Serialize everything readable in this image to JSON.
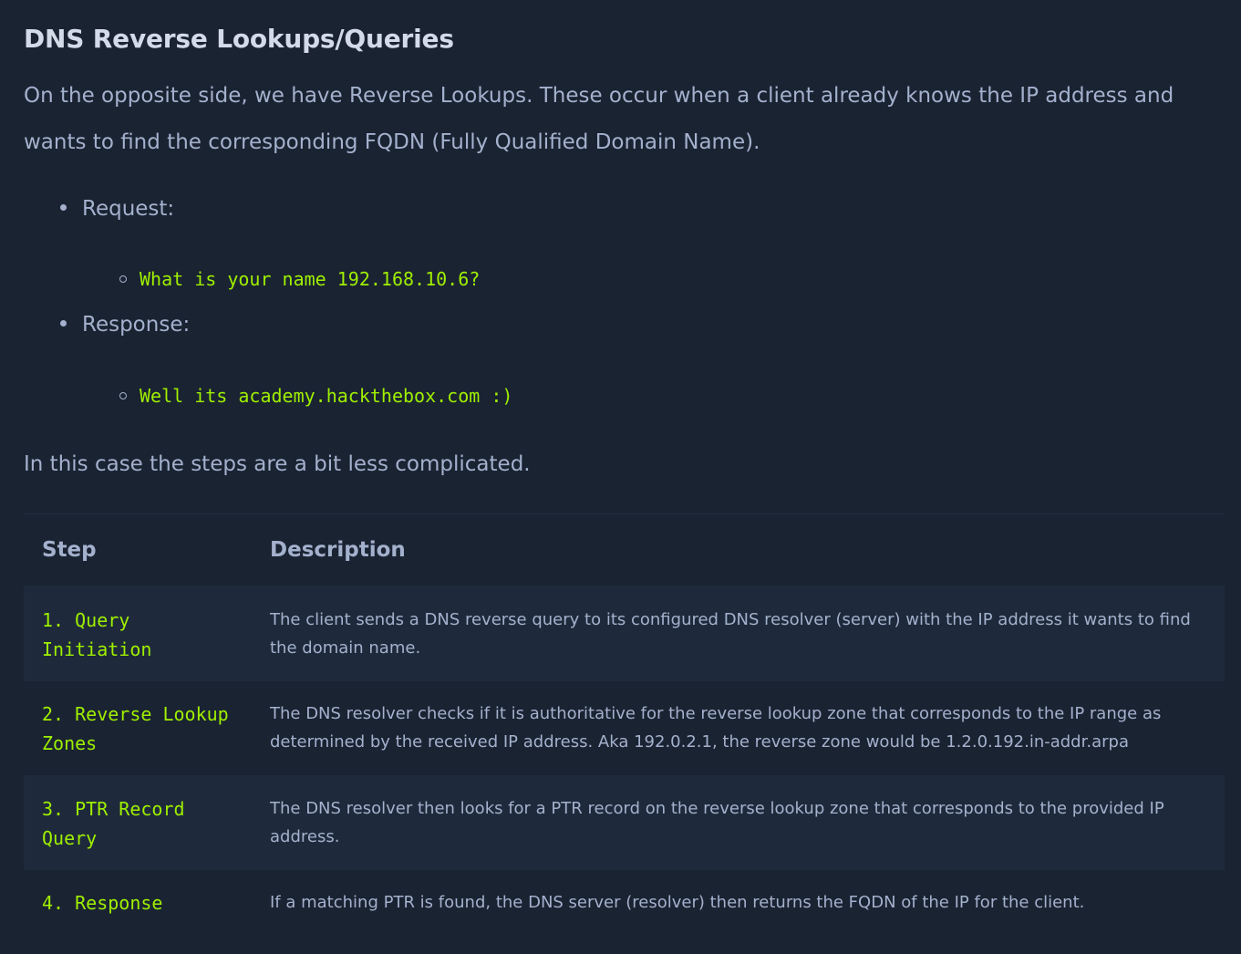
{
  "title": "DNS Reverse Lookups/Queries",
  "intro": "On the opposite side, we have Reverse Lookups. These occur when a client already knows the IP address and wants to find the corresponding FQDN (Fully Qualified Domain Name).",
  "bullets": [
    {
      "label": "Request:",
      "code": "What is your name 192.168.10.6?"
    },
    {
      "label": "Response:",
      "code": "Well its academy.hackthebox.com :)"
    }
  ],
  "note": "In this case the steps are a bit less complicated.",
  "table": {
    "headers": [
      "Step",
      "Description"
    ],
    "rows": [
      {
        "step": "1. Query Initiation",
        "desc": "The client sends a DNS reverse query to its configured DNS resolver (server) with the IP address it wants to find the domain name."
      },
      {
        "step": "2. Reverse Lookup Zones",
        "desc": "The DNS resolver checks if it is authoritative for the reverse lookup zone that corresponds to the IP range as determined by the received IP address. Aka 192.0.2.1, the reverse zone would be 1.2.0.192.in-addr.arpa"
      },
      {
        "step": "3. PTR Record Query",
        "desc": "The DNS resolver then looks for a PTR record on the reverse lookup zone that corresponds to the provided IP address."
      },
      {
        "step": "4. Response",
        "desc": "If a matching PTR is found, the DNS server (resolver) then returns the FQDN of the IP for the client."
      }
    ]
  }
}
